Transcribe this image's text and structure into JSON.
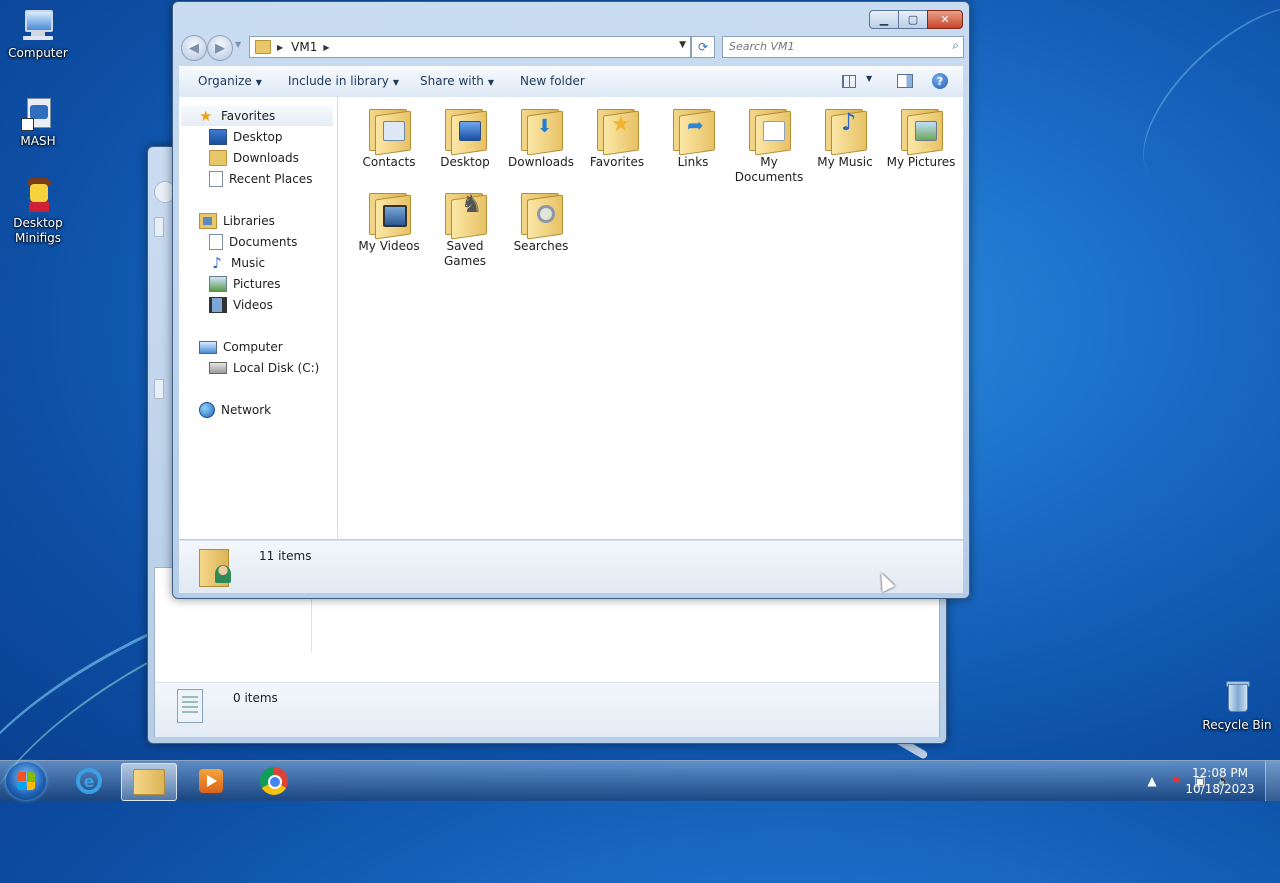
{
  "desktop": {
    "icons": [
      {
        "label": "Computer"
      },
      {
        "label": "MASH"
      },
      {
        "label": "Desktop Minifigs"
      },
      {
        "label": "Recycle Bin"
      }
    ]
  },
  "back_window": {
    "status": "0 items"
  },
  "explorer": {
    "address": {
      "crumb": "VM1"
    },
    "search": {
      "placeholder": "Search VM1"
    },
    "toolbar": {
      "organize": "Organize",
      "include": "Include in library",
      "share": "Share with",
      "new_folder": "New folder"
    },
    "nav": {
      "favorites": "Favorites",
      "desktop": "Desktop",
      "downloads": "Downloads",
      "recent": "Recent Places",
      "libraries": "Libraries",
      "documents": "Documents",
      "music": "Music",
      "pictures": "Pictures",
      "videos": "Videos",
      "computer": "Computer",
      "local_disk": "Local Disk (C:)",
      "network": "Network"
    },
    "items": [
      {
        "label": "Contacts"
      },
      {
        "label": "Desktop"
      },
      {
        "label": "Downloads"
      },
      {
        "label": "Favorites"
      },
      {
        "label": "Links"
      },
      {
        "label": "My Documents"
      },
      {
        "label": "My Music"
      },
      {
        "label": "My Pictures"
      },
      {
        "label": "My Videos"
      },
      {
        "label": "Saved Games"
      },
      {
        "label": "Searches"
      }
    ],
    "status": "11 items"
  },
  "taskbar": {
    "time": "12:08 PM",
    "date": "10/18/2023"
  },
  "colors": {
    "desktop": "#1a6cc6",
    "window_frame": "#b6cde8",
    "close_button": "#c8452b"
  }
}
